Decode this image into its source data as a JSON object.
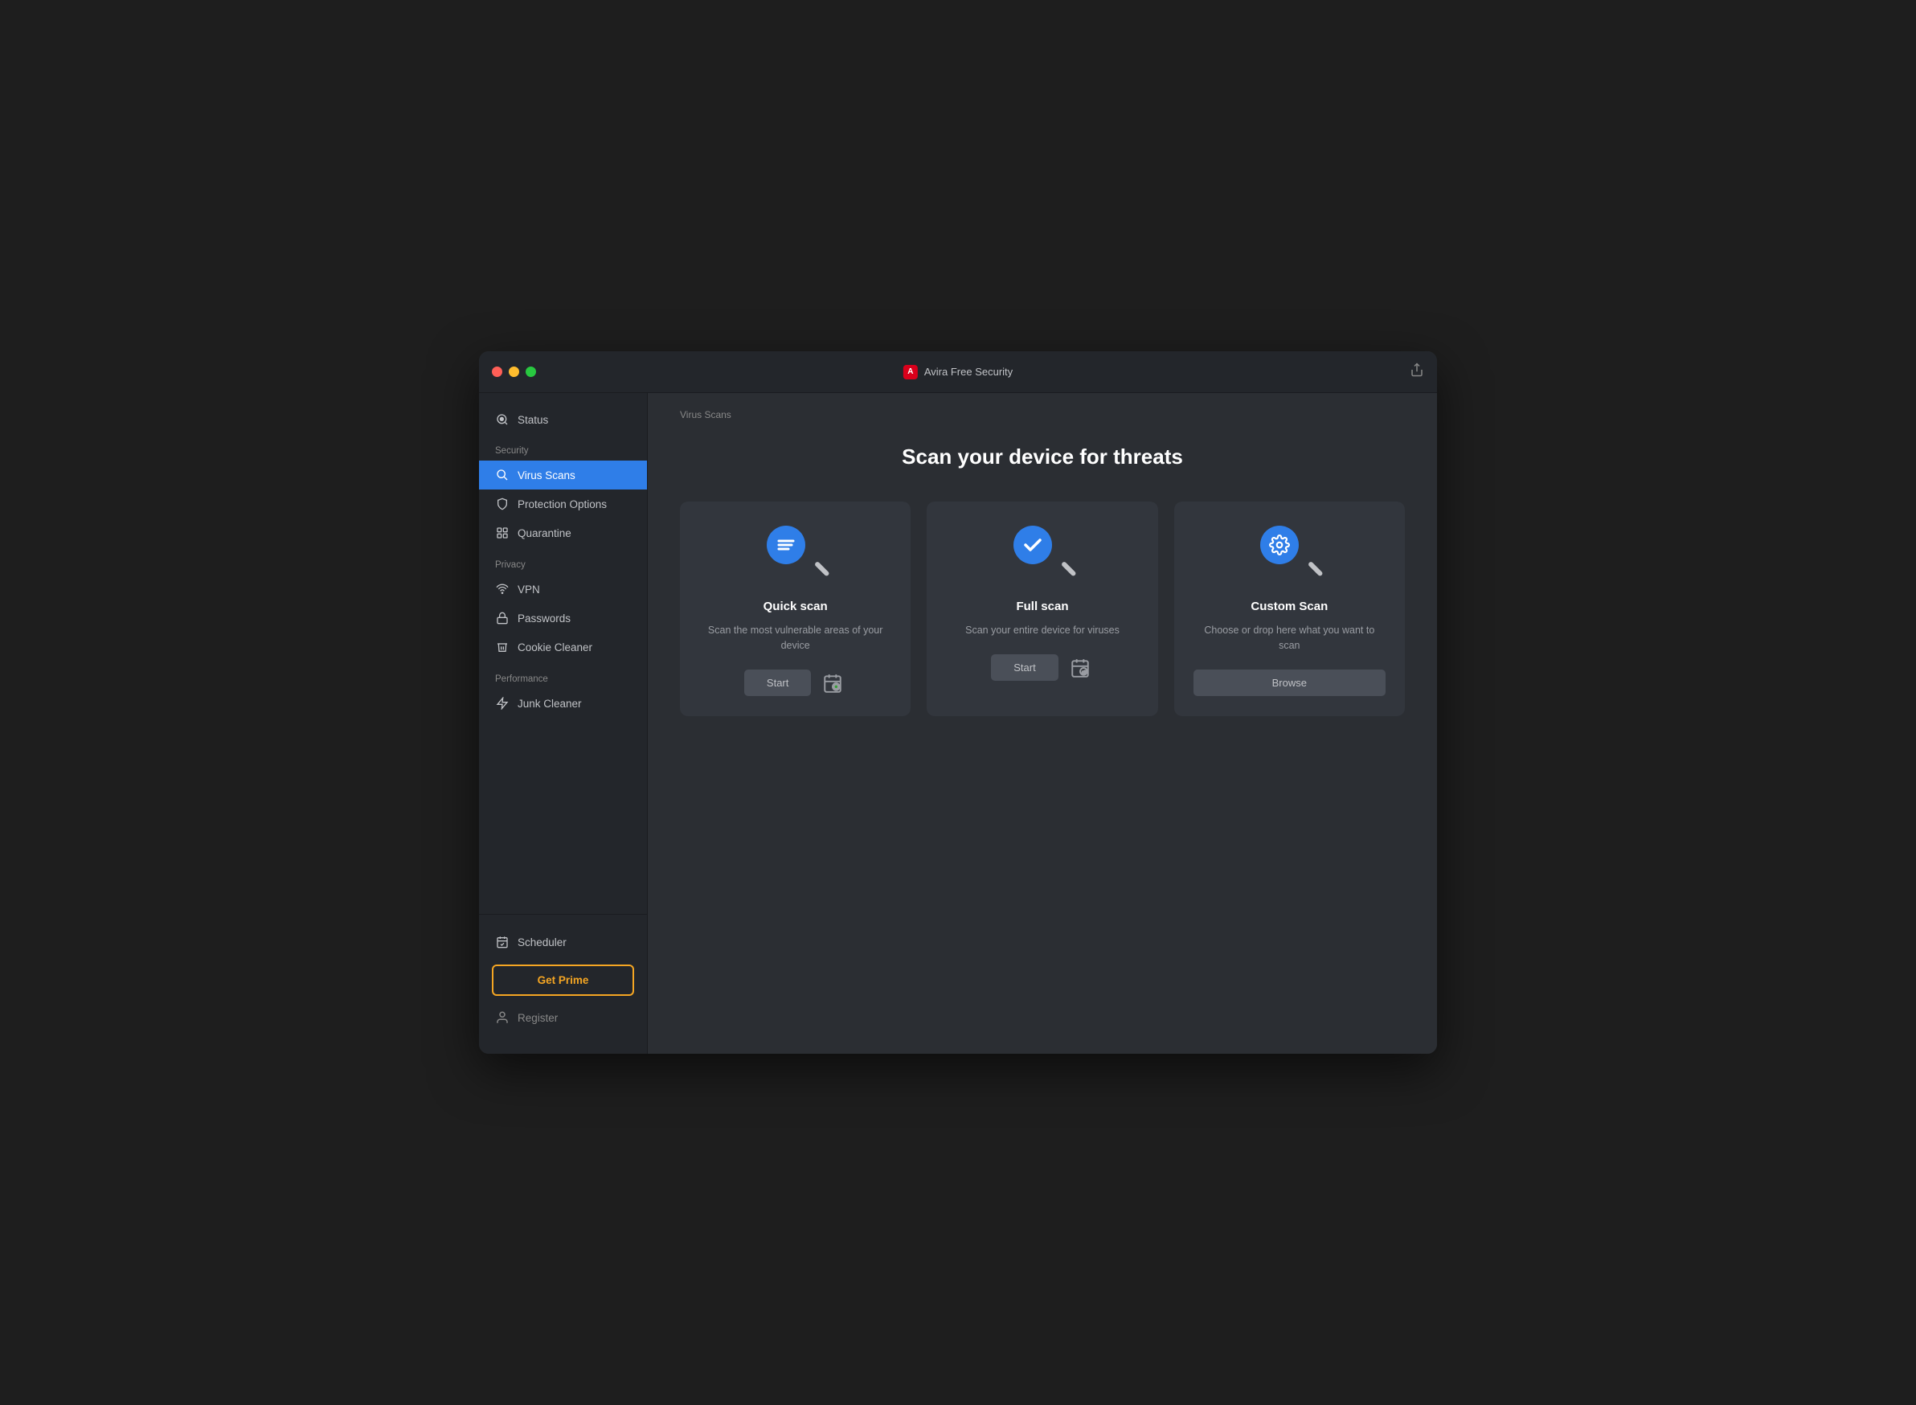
{
  "window": {
    "title": "Avira Free Security"
  },
  "sidebar": {
    "status_label": "Status",
    "sections": [
      {
        "label": "Security",
        "items": [
          {
            "id": "virus-scans",
            "label": "Virus Scans",
            "active": true,
            "icon": "search"
          },
          {
            "id": "protection-options",
            "label": "Protection Options",
            "active": false,
            "icon": "shield"
          },
          {
            "id": "quarantine",
            "label": "Quarantine",
            "active": false,
            "icon": "grid"
          }
        ]
      },
      {
        "label": "Privacy",
        "items": [
          {
            "id": "vpn",
            "label": "VPN",
            "active": false,
            "icon": "wifi"
          },
          {
            "id": "passwords",
            "label": "Passwords",
            "active": false,
            "icon": "lock"
          },
          {
            "id": "cookie-cleaner",
            "label": "Cookie Cleaner",
            "active": false,
            "icon": "trash"
          }
        ]
      },
      {
        "label": "Performance",
        "items": [
          {
            "id": "junk-cleaner",
            "label": "Junk Cleaner",
            "active": false,
            "icon": "rocket"
          }
        ]
      }
    ],
    "scheduler_label": "Scheduler",
    "get_prime_label": "Get Prime",
    "register_label": "Register"
  },
  "content": {
    "breadcrumb": "Virus Scans",
    "page_title": "Scan your device for threats",
    "cards": [
      {
        "id": "quick-scan",
        "title": "Quick scan",
        "description": "Scan the most vulnerable areas of your device",
        "icon_type": "lines",
        "action": "start",
        "action_label": "Start",
        "has_schedule": true
      },
      {
        "id": "full-scan",
        "title": "Full scan",
        "description": "Scan your entire device for viruses",
        "icon_type": "checkmark",
        "action": "start",
        "action_label": "Start",
        "has_schedule": true
      },
      {
        "id": "custom-scan",
        "title": "Custom Scan",
        "description": "Choose or drop here what you want to scan",
        "icon_type": "gear",
        "action": "browse",
        "action_label": "Browse",
        "has_schedule": false
      }
    ]
  }
}
